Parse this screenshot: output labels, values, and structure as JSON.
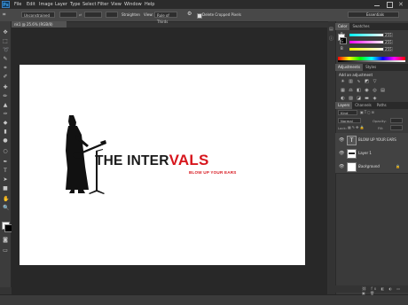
{
  "app": {
    "logo": "Ps"
  },
  "menu": [
    "File",
    "Edit",
    "Image",
    "Layer",
    "Type",
    "Select",
    "Filter",
    "View",
    "Window",
    "Help"
  ],
  "options": {
    "preset": "Unconstrained",
    "straighten_label": "Straighten",
    "view_label": "View:",
    "view_value": "Rule of Thirds",
    "delete_cropped_label": "Delete Cropped Pixels",
    "workspace": "Essentials"
  },
  "document": {
    "tab_label": "nk1 @ 25.6% (RGB/8)"
  },
  "artwork": {
    "title_black": "THE INTER",
    "title_red": "VALS",
    "tagline": "BLOW UP YOUR EARS"
  },
  "panels": {
    "color_tabs": [
      "Color",
      "Swatches"
    ],
    "color": {
      "r_label": "R",
      "g_label": "G",
      "b_label": "B",
      "r_value": "255",
      "g_value": "255",
      "b_value": "255"
    },
    "adjust_tabs": [
      "Adjustments",
      "Styles"
    ],
    "adjust_label": "Add an adjustment",
    "layers_tabs": [
      "Layers",
      "Channels",
      "Paths"
    ],
    "kind_label": "Kind",
    "blend_mode": "Normal",
    "opacity_label": "Opacity:",
    "lock_label": "Lock:",
    "fill_label": "Fill:",
    "layers": [
      {
        "name": "BLOW UP YOUR EARS",
        "thumb": "T"
      },
      {
        "name": "Layer 1",
        "thumb": ""
      },
      {
        "name": "Background",
        "thumb": ""
      }
    ]
  },
  "colors": {
    "accent_red": "#d7161d",
    "foreground": "#ffffff",
    "background": "#000000"
  }
}
